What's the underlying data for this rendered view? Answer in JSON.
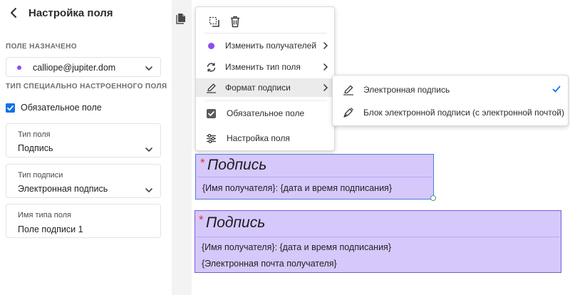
{
  "panel": {
    "title": "Настройка поля",
    "assigned_section": "ПОЛЕ НАЗНАЧЕНО",
    "assignee": "calliope@jupiter.dom",
    "custom_section": "ТИП СПЕЦИАЛЬНО НАСТРОЕННОГО ПОЛЯ",
    "required_label": "Обязательное поле",
    "field_type": {
      "label": "Тип поля",
      "value": "Подпись"
    },
    "signature_type": {
      "label": "Тип подписи",
      "value": "Электронная подпись"
    },
    "field_type_name": {
      "label": "Имя типа поля",
      "value": "Поле подписи 1"
    }
  },
  "menu": {
    "items": [
      {
        "label": "Изменить получателей",
        "icon": "recipient-dot-icon"
      },
      {
        "label": "Изменить тип поля",
        "icon": "sync-icon"
      },
      {
        "label": "Формат подписи",
        "icon": "signature-pen-icon"
      },
      {
        "label": "Обязательное поле",
        "icon": "checkbox-icon"
      },
      {
        "label": "Настройка поля",
        "icon": "settings-sliders-icon"
      }
    ],
    "submenu": [
      {
        "label": "Электронная подпись",
        "icon": "signature-pen-icon",
        "checked": true
      },
      {
        "label": "Блок электронной подписи (с электронной почтой)",
        "icon": "pen-nib-icon",
        "checked": false
      }
    ]
  },
  "fields": {
    "sig1": {
      "star": "*",
      "title": "Подпись",
      "line1": "{Имя получателя}: {дата и время подписания}"
    },
    "sig2": {
      "star": "*",
      "title": "Подпись",
      "line1": "{Имя получателя}: {дата и время подписания}",
      "line2": "{Электронная почта получателя}"
    }
  },
  "colors": {
    "accent": "#1473e6",
    "recipient": "#8a4df0",
    "field_fill": "#d6c8fb",
    "field_border_selected": "#4b7cd8",
    "field_border": "#7a5bd4",
    "required_star": "#e2343a"
  }
}
